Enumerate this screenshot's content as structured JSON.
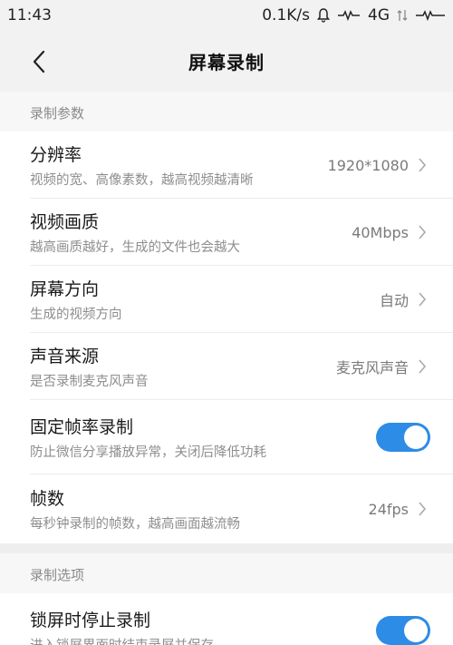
{
  "status_bar": {
    "time": "11:43",
    "speed": "0.1K/s",
    "network": "4G"
  },
  "header": {
    "title": "屏幕录制"
  },
  "sections": [
    {
      "title": "录制参数",
      "items": [
        {
          "title": "分辨率",
          "subtitle": "视频的宽、高像素数，越高视频越清晰",
          "value": "1920*1080"
        },
        {
          "title": "视频画质",
          "subtitle": "越高画质越好，生成的文件也会越大",
          "value": "40Mbps"
        },
        {
          "title": "屏幕方向",
          "subtitle": "生成的视频方向",
          "value": "自动"
        },
        {
          "title": "声音来源",
          "subtitle": "是否录制麦克风声音",
          "value": "麦克风声音"
        },
        {
          "title": "固定帧率录制",
          "subtitle": "防止微信分享播放异常，关闭后降低功耗",
          "toggle_on": true
        },
        {
          "title": "帧数",
          "subtitle": "每秒钟录制的帧数，越高画面越流畅",
          "value": "24fps"
        }
      ]
    },
    {
      "title": "录制选项",
      "items": [
        {
          "title": "锁屏时停止录制",
          "subtitle": "进入锁屏界面时结束录屏并保存",
          "toggle_on": true
        }
      ]
    }
  ],
  "colors": {
    "accent": "#2d8ce6"
  }
}
